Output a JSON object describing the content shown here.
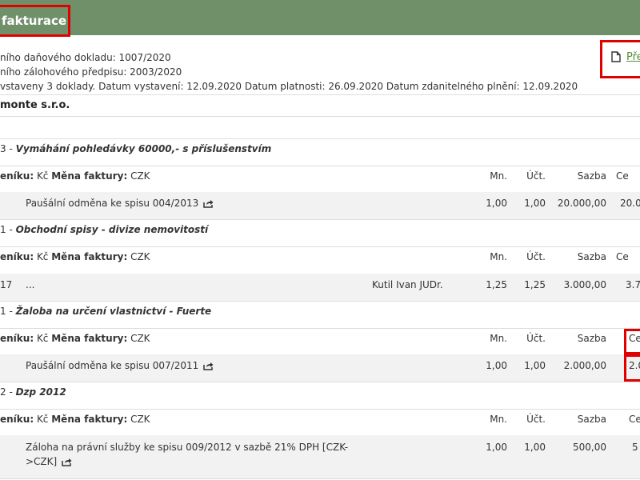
{
  "header": {
    "title": "fakturace"
  },
  "info": {
    "line1": "ního daňového dokladu: 1007/2020",
    "line2": "ního zálohového předpisu: 2003/2020",
    "line3": "vstaveny 3 doklady. Datum vystavení: 12.09.2020 Datum platnosti: 26.09.2020 Datum zdanitelného plnění: 12.09.2020"
  },
  "preview": {
    "label": "Pře"
  },
  "company": "monte s.r.o.",
  "sections": [
    {
      "prefix": "3 - ",
      "title": "Vymáhání pohledávky 60000,- s příslušenstvím",
      "currency_label": "eníku:",
      "currency_value": " Kč ",
      "invoice_currency_label": "Měna faktury:",
      "invoice_currency_value": " CZK",
      "col_mn": "Mn.",
      "col_uct": "Účt.",
      "col_sazba": "Sazba",
      "col_cena": "Ce",
      "item": {
        "left": "",
        "desc": "Paušální odměna ke spisu 004/2013",
        "person": "",
        "mn": "1,00",
        "uct": "1,00",
        "sazba": "20.000,00",
        "cena": "20.0"
      }
    },
    {
      "prefix": "1 - ",
      "title": "Obchodní spisy - divize nemovitostí",
      "currency_label": "eníku:",
      "currency_value": " Kč ",
      "invoice_currency_label": "Měna faktury:",
      "invoice_currency_value": " CZK",
      "col_mn": "Mn.",
      "col_uct": "Účt.",
      "col_sazba": "Sazba",
      "col_cena": "Ce",
      "item": {
        "left": "17",
        "desc": "...",
        "person": "Kutil Ivan JUDr.",
        "mn": "1,25",
        "uct": "1,25",
        "sazba": "3.000,00",
        "cena": "3.7"
      }
    },
    {
      "prefix": "1 - ",
      "title": "Žaloba na určení vlastnictví - Fuerte",
      "currency_label": "eníku:",
      "currency_value": " Kč ",
      "invoice_currency_label": "Měna faktury:",
      "invoice_currency_value": " CZK",
      "col_mn": "Mn.",
      "col_uct": "Účt.",
      "col_sazba": "Sazba",
      "col_cena": "Ce",
      "item": {
        "left": "",
        "desc": "Paušální odměna ke spisu 007/2011",
        "person": "",
        "mn": "1,00",
        "uct": "1,00",
        "sazba": "2.000,00",
        "cena": "2.0"
      }
    },
    {
      "prefix": "2 - ",
      "title": "Dzp 2012",
      "currency_label": "eníku:",
      "currency_value": " Kč ",
      "invoice_currency_label": "Měna faktury:",
      "invoice_currency_value": " CZK",
      "col_mn": "Mn.",
      "col_uct": "Účt.",
      "col_sazba": "Sazba",
      "col_cena": "Ce",
      "item": {
        "left": "",
        "desc": "Záloha na právní služby ke spisu 009/2012 v sazbě 21% DPH [CZK-",
        "desc2": ">CZK]",
        "person": "",
        "mn": "1,00",
        "uct": "1,00",
        "sazba": "500,00",
        "cena": "5"
      }
    }
  ]
}
